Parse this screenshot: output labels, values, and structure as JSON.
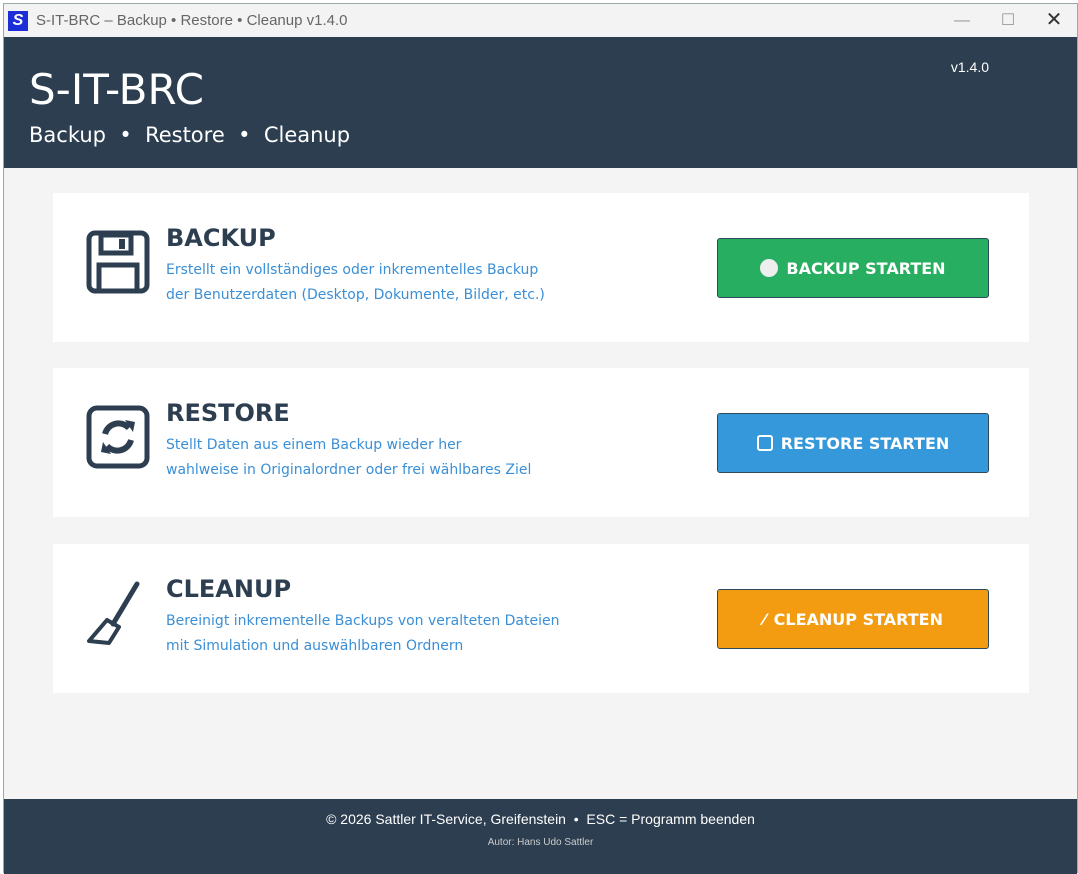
{
  "window": {
    "title": "S-IT-BRC – Backup • Restore • Cleanup  v1.4.0",
    "icon_letter": "S"
  },
  "header": {
    "title": "S-IT-BRC",
    "subtitle": "Backup  •  Restore  •  Cleanup",
    "version": "v1.4.0"
  },
  "cards": [
    {
      "title": "BACKUP",
      "desc1": "Erstellt ein vollständiges oder inkrementelles Backup",
      "desc2": "der Benutzerdaten (Desktop, Dokumente, Bilder, etc.)",
      "button": "BACKUP STARTEN",
      "color": "#27ae60"
    },
    {
      "title": "RESTORE",
      "desc1": "Stellt Daten aus einem Backup wieder her",
      "desc2": "wahlweise in Originalordner oder frei wählbares Ziel",
      "button": "RESTORE STARTEN",
      "color": "#3498db"
    },
    {
      "title": "CLEANUP",
      "desc1": "Bereinigt inkrementelle Backups von veralteten Dateien",
      "desc2": "mit Simulation und auswählbaren Ordnern",
      "button": "CLEANUP STARTEN",
      "color": "#f39c12"
    }
  ],
  "footer": {
    "line1": "© 2026 Sattler IT-Service, Greifenstein  •  ESC = Programm beenden",
    "line2": "Autor: Hans Udo Sattler"
  }
}
